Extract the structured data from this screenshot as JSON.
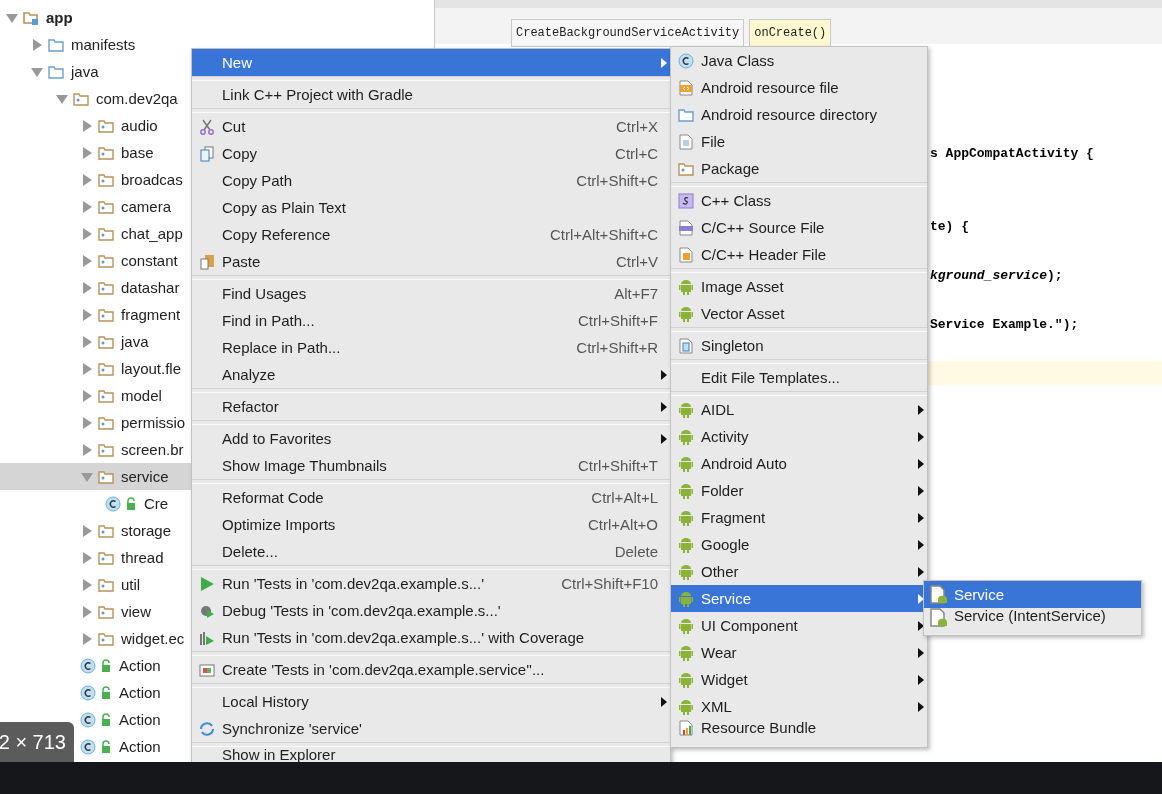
{
  "tree": [
    {
      "label": "app",
      "kind": "module",
      "expanded": true,
      "selected": false,
      "children": [
        {
          "label": "manifests",
          "kind": "folder",
          "expanded": false,
          "selected": false
        },
        {
          "label": "java",
          "kind": "folder",
          "expanded": true,
          "selected": false,
          "children": [
            {
              "label": "com.dev2qa",
              "kind": "package",
              "expanded": true,
              "selected": false,
              "children": [
                {
                  "label": "audio",
                  "kind": "package",
                  "expanded": false,
                  "selected": false
                },
                {
                  "label": "base",
                  "kind": "package",
                  "expanded": false,
                  "selected": false
                },
                {
                  "label": "broadcas",
                  "kind": "package",
                  "expanded": false,
                  "selected": false
                },
                {
                  "label": "camera",
                  "kind": "package",
                  "expanded": false,
                  "selected": false
                },
                {
                  "label": "chat_app",
                  "kind": "package",
                  "expanded": false,
                  "selected": false
                },
                {
                  "label": "constant",
                  "kind": "package",
                  "expanded": false,
                  "selected": false
                },
                {
                  "label": "datashar",
                  "kind": "package",
                  "expanded": false,
                  "selected": false
                },
                {
                  "label": "fragment",
                  "kind": "package",
                  "expanded": false,
                  "selected": false
                },
                {
                  "label": "java",
                  "kind": "package",
                  "expanded": false,
                  "selected": false
                },
                {
                  "label": "layout.fle",
                  "kind": "package",
                  "expanded": false,
                  "selected": false
                },
                {
                  "label": "model",
                  "kind": "package",
                  "expanded": false,
                  "selected": false
                },
                {
                  "label": "permissio",
                  "kind": "package",
                  "expanded": false,
                  "selected": false
                },
                {
                  "label": "screen.br",
                  "kind": "package",
                  "expanded": false,
                  "selected": false
                },
                {
                  "label": "service",
                  "kind": "package",
                  "expanded": true,
                  "selected": true,
                  "children": [
                    {
                      "label": "Cre",
                      "kind": "class",
                      "selected": false
                    }
                  ]
                },
                {
                  "label": "storage",
                  "kind": "package",
                  "expanded": false,
                  "selected": false
                },
                {
                  "label": "thread",
                  "kind": "package",
                  "expanded": false,
                  "selected": false
                },
                {
                  "label": "util",
                  "kind": "package",
                  "expanded": false,
                  "selected": false
                },
                {
                  "label": "view",
                  "kind": "package",
                  "expanded": false,
                  "selected": false
                },
                {
                  "label": "widget.ec",
                  "kind": "package",
                  "expanded": false,
                  "selected": false
                },
                {
                  "label": "Action",
                  "kind": "class",
                  "selected": false
                },
                {
                  "label": "Action",
                  "kind": "class",
                  "selected": false
                },
                {
                  "label": "Action",
                  "kind": "class",
                  "selected": false
                },
                {
                  "label": "Action",
                  "kind": "class",
                  "selected": false
                }
              ]
            }
          ]
        }
      ]
    }
  ],
  "editor": {
    "breadcrumbs": [
      {
        "label": "CreateBackgroundServiceActivity",
        "selected": false
      },
      {
        "label": "onCreate()",
        "selected": true
      }
    ],
    "code_lines": [
      {
        "kind": "blank"
      },
      {
        "kind": "blank"
      },
      {
        "kind": "blank"
      },
      {
        "kind": "blank"
      },
      {
        "kind": "keyword",
        "text": "**s** AppCompatActivity {"
      },
      {
        "kind": "blank"
      },
      {
        "kind": "blank"
      },
      {
        "kind": "plain",
        "text": "te) {"
      },
      {
        "kind": "blank"
      },
      {
        "kind": "field",
        "text": "*kground_service*);"
      },
      {
        "kind": "blank"
      },
      {
        "kind": "string",
        "text": "**Service Example.\"**);"
      },
      {
        "kind": "blank"
      },
      {
        "kind": "current"
      }
    ]
  },
  "context_menu": [
    {
      "kind": "plain",
      "label": "New",
      "submenu": true,
      "selected": true
    },
    {
      "kind": "separator"
    },
    {
      "kind": "plain",
      "label": "Link C++ Project with Gradle",
      "submenu": false,
      "selected": false
    },
    {
      "kind": "separator"
    },
    {
      "kind": "cut",
      "label": "Cut",
      "shortcut": "Ctrl+X",
      "submenu": false,
      "selected": false
    },
    {
      "kind": "copy",
      "label": "Copy",
      "shortcut": "Ctrl+C",
      "submenu": false,
      "selected": false
    },
    {
      "kind": "plain",
      "label": "Copy Path",
      "shortcut": "Ctrl+Shift+C",
      "submenu": false,
      "selected": false
    },
    {
      "kind": "plain",
      "label": "Copy as Plain Text",
      "submenu": false,
      "selected": false
    },
    {
      "kind": "plain",
      "label": "Copy Reference",
      "shortcut": "Ctrl+Alt+Shift+C",
      "submenu": false,
      "selected": false
    },
    {
      "kind": "paste",
      "label": "Paste",
      "shortcut": "Ctrl+V",
      "submenu": false,
      "selected": false
    },
    {
      "kind": "separator"
    },
    {
      "kind": "plain",
      "label": "Find Usages",
      "shortcut": "Alt+F7",
      "submenu": false,
      "selected": false
    },
    {
      "kind": "plain",
      "label": "Find in Path...",
      "shortcut": "Ctrl+Shift+F",
      "submenu": false,
      "selected": false
    },
    {
      "kind": "plain",
      "label": "Replace in Path...",
      "shortcut": "Ctrl+Shift+R",
      "submenu": false,
      "selected": false
    },
    {
      "kind": "plain",
      "label": "Analyze",
      "submenu": true,
      "selected": false
    },
    {
      "kind": "separator"
    },
    {
      "kind": "plain",
      "label": "Refactor",
      "submenu": true,
      "selected": false
    },
    {
      "kind": "separator"
    },
    {
      "kind": "plain",
      "label": "Add to Favorites",
      "submenu": true,
      "selected": false
    },
    {
      "kind": "plain",
      "label": "Show Image Thumbnails",
      "shortcut": "Ctrl+Shift+T",
      "submenu": false,
      "selected": false
    },
    {
      "kind": "separator"
    },
    {
      "kind": "plain",
      "label": "Reformat Code",
      "shortcut": "Ctrl+Alt+L",
      "submenu": false,
      "selected": false
    },
    {
      "kind": "plain",
      "label": "Optimize Imports",
      "shortcut": "Ctrl+Alt+O",
      "submenu": false,
      "selected": false
    },
    {
      "kind": "plain",
      "label": "Delete...",
      "shortcut": "Delete",
      "submenu": false,
      "selected": false
    },
    {
      "kind": "separator"
    },
    {
      "kind": "run",
      "label": "Run 'Tests in 'com.dev2qa.example.s...'",
      "shortcut": "Ctrl+Shift+F10",
      "submenu": false,
      "selected": false
    },
    {
      "kind": "debug",
      "label": "Debug 'Tests in 'com.dev2qa.example.s...'",
      "submenu": false,
      "selected": false
    },
    {
      "kind": "coverage",
      "label": "Run 'Tests in 'com.dev2qa.example.s...' with Coverage",
      "submenu": false,
      "selected": false
    },
    {
      "kind": "separator"
    },
    {
      "kind": "create",
      "label": "Create 'Tests in 'com.dev2qa.example.service''...",
      "submenu": false,
      "selected": false
    },
    {
      "kind": "separator"
    },
    {
      "kind": "plain",
      "label": "Local History",
      "submenu": true,
      "selected": false
    },
    {
      "kind": "sync",
      "label": "Synchronize 'service'",
      "submenu": false,
      "selected": false
    },
    {
      "kind": "separator"
    },
    {
      "kind": "plain",
      "label": "Show in Explorer",
      "submenu": false,
      "selected": false
    }
  ],
  "new_submenu": [
    {
      "kind": "javaclass",
      "label": "Java Class",
      "submenu": false,
      "selected": false
    },
    {
      "kind": "resfile",
      "label": "Android resource file",
      "submenu": false,
      "selected": false
    },
    {
      "kind": "folder",
      "label": "Android resource directory",
      "submenu": false,
      "selected": false
    },
    {
      "kind": "file",
      "label": "File",
      "submenu": false,
      "selected": false
    },
    {
      "kind": "package",
      "label": "Package",
      "submenu": false,
      "selected": false
    },
    {
      "kind": "separator"
    },
    {
      "kind": "cppclass",
      "label": "C++ Class",
      "submenu": false,
      "selected": false
    },
    {
      "kind": "cppsource",
      "label": "C/C++ Source File",
      "submenu": false,
      "selected": false
    },
    {
      "kind": "header",
      "label": "C/C++ Header File",
      "submenu": false,
      "selected": false
    },
    {
      "kind": "separator"
    },
    {
      "kind": "android",
      "label": "Image Asset",
      "submenu": false,
      "selected": false
    },
    {
      "kind": "android",
      "label": "Vector Asset",
      "submenu": false,
      "selected": false
    },
    {
      "kind": "separator"
    },
    {
      "kind": "singleton",
      "label": "Singleton",
      "submenu": false,
      "selected": false
    },
    {
      "kind": "separator"
    },
    {
      "kind": "plain",
      "label": "Edit File Templates...",
      "submenu": false,
      "selected": false
    },
    {
      "kind": "separator"
    },
    {
      "kind": "android",
      "label": "AIDL",
      "submenu": true,
      "selected": false
    },
    {
      "kind": "android",
      "label": "Activity",
      "submenu": true,
      "selected": false
    },
    {
      "kind": "android",
      "label": "Android Auto",
      "submenu": true,
      "selected": false
    },
    {
      "kind": "android",
      "label": "Folder",
      "submenu": true,
      "selected": false
    },
    {
      "kind": "android",
      "label": "Fragment",
      "submenu": true,
      "selected": false
    },
    {
      "kind": "android",
      "label": "Google",
      "submenu": true,
      "selected": false
    },
    {
      "kind": "android",
      "label": "Other",
      "submenu": true,
      "selected": false
    },
    {
      "kind": "android",
      "label": "Service",
      "submenu": true,
      "selected": true
    },
    {
      "kind": "android",
      "label": "UI Component",
      "submenu": true,
      "selected": false
    },
    {
      "kind": "android",
      "label": "Wear",
      "submenu": true,
      "selected": false
    },
    {
      "kind": "android",
      "label": "Widget",
      "submenu": true,
      "selected": false
    },
    {
      "kind": "android",
      "label": "XML",
      "submenu": true,
      "selected": false
    },
    {
      "kind": "bundle",
      "label": "Resource Bundle",
      "submenu": false,
      "selected": false
    }
  ],
  "service_submenu": [
    {
      "kind": "servicefile",
      "label": "Service",
      "submenu": false,
      "selected": true
    },
    {
      "kind": "servicefile",
      "label": "Service (IntentService)",
      "submenu": false,
      "selected": false
    }
  ],
  "image_size_badge": "2 × 713"
}
